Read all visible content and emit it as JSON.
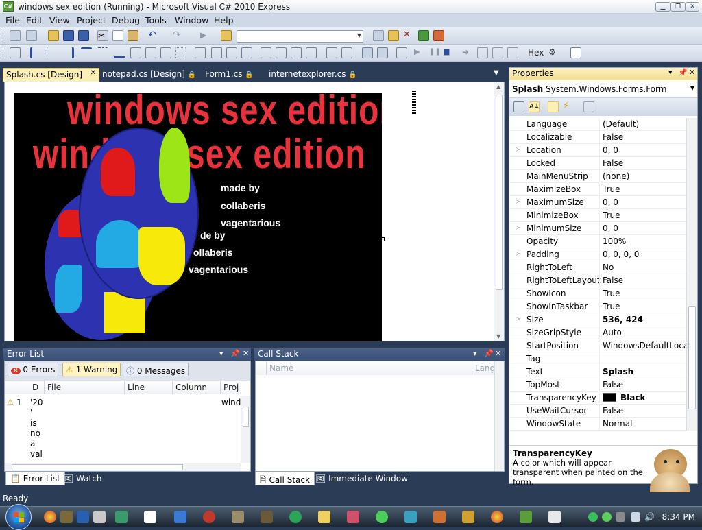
{
  "window": {
    "title": "windows sex edition (Running) - Microsoft Visual C# 2010 Express",
    "app_icon": "C#",
    "controls": [
      "minimize",
      "maximize",
      "close"
    ]
  },
  "menu": [
    "File",
    "Edit",
    "View",
    "Project",
    "Debug",
    "Tools",
    "Window",
    "Help"
  ],
  "toolbar": {
    "combo_value": "",
    "hex_label": "Hex"
  },
  "doc_tabs": [
    {
      "label": "Splash.cs [Design]",
      "active": true
    },
    {
      "label": "notepad.cs [Design]",
      "active": false
    },
    {
      "label": "Form1.cs",
      "active": false
    },
    {
      "label": "internetexplorer.cs",
      "active": false
    }
  ],
  "designer": {
    "title_line1": "windows sex edition",
    "title_line2": "windows sex edition",
    "credits_a": [
      "made by",
      "collaberis",
      "vagentarious"
    ],
    "credits_b": [
      "de by",
      "ollaberis",
      "vagentarious"
    ]
  },
  "error_list": {
    "title": "Error List",
    "filters": [
      "0 Errors",
      "1 Warning",
      "0 Messages"
    ],
    "columns": [
      "D",
      "File",
      "Line",
      "Column",
      "Proj"
    ],
    "rows": [
      {
        "num": "1",
        "desc_lines": [
          "'20",
          "'",
          "is",
          "no",
          "a",
          "val"
        ],
        "project": "wind"
      }
    ],
    "tabs": [
      "Error List",
      "Watch"
    ]
  },
  "call_stack": {
    "title": "Call Stack",
    "columns": [
      "Name",
      "Lang"
    ],
    "tabs": [
      "Call Stack",
      "Immediate Window"
    ]
  },
  "properties": {
    "title": "Properties",
    "object_name": "Splash",
    "object_type": "System.Windows.Forms.Form",
    "rows": [
      {
        "name": "Language",
        "value": "(Default)",
        "expandable": false,
        "bold": false
      },
      {
        "name": "Localizable",
        "value": "False",
        "expandable": false,
        "bold": false
      },
      {
        "name": "Location",
        "value": "0, 0",
        "expandable": true,
        "bold": false
      },
      {
        "name": "Locked",
        "value": "False",
        "expandable": false,
        "bold": false
      },
      {
        "name": "MainMenuStrip",
        "value": "(none)",
        "expandable": false,
        "bold": false
      },
      {
        "name": "MaximizeBox",
        "value": "True",
        "expandable": false,
        "bold": false
      },
      {
        "name": "MaximumSize",
        "value": "0, 0",
        "expandable": true,
        "bold": false
      },
      {
        "name": "MinimizeBox",
        "value": "True",
        "expandable": false,
        "bold": false
      },
      {
        "name": "MinimumSize",
        "value": "0, 0",
        "expandable": true,
        "bold": false
      },
      {
        "name": "Opacity",
        "value": "100%",
        "expandable": false,
        "bold": false
      },
      {
        "name": "Padding",
        "value": "0, 0, 0, 0",
        "expandable": true,
        "bold": false
      },
      {
        "name": "RightToLeft",
        "value": "No",
        "expandable": false,
        "bold": false
      },
      {
        "name": "RightToLeftLayout",
        "value": "False",
        "expandable": false,
        "bold": false
      },
      {
        "name": "ShowIcon",
        "value": "True",
        "expandable": false,
        "bold": false
      },
      {
        "name": "ShowInTaskbar",
        "value": "True",
        "expandable": false,
        "bold": false
      },
      {
        "name": "Size",
        "value": "536, 424",
        "expandable": true,
        "bold": true
      },
      {
        "name": "SizeGripStyle",
        "value": "Auto",
        "expandable": false,
        "bold": false
      },
      {
        "name": "StartPosition",
        "value": "WindowsDefaultLocatio",
        "expandable": false,
        "bold": false
      },
      {
        "name": "Tag",
        "value": "",
        "expandable": false,
        "bold": false
      },
      {
        "name": "Text",
        "value": "Splash",
        "expandable": false,
        "bold": true
      },
      {
        "name": "TopMost",
        "value": "False",
        "expandable": false,
        "bold": false
      },
      {
        "name": "TransparencyKey",
        "value": "Black",
        "expandable": false,
        "bold": true,
        "swatch": "#000000"
      },
      {
        "name": "UseWaitCursor",
        "value": "False",
        "expandable": false,
        "bold": false
      },
      {
        "name": "WindowState",
        "value": "Normal",
        "expandable": false,
        "bold": false
      }
    ],
    "description_title": "TransparencyKey",
    "description_text": "A color which will appear transparent when painted on the form."
  },
  "status": "Ready",
  "taskbar": {
    "clock": "8:34 PM"
  },
  "colors": {
    "title_red": "#e8323c",
    "active_tab": "#fcf0b5",
    "ide_background": "#2b3c57"
  }
}
